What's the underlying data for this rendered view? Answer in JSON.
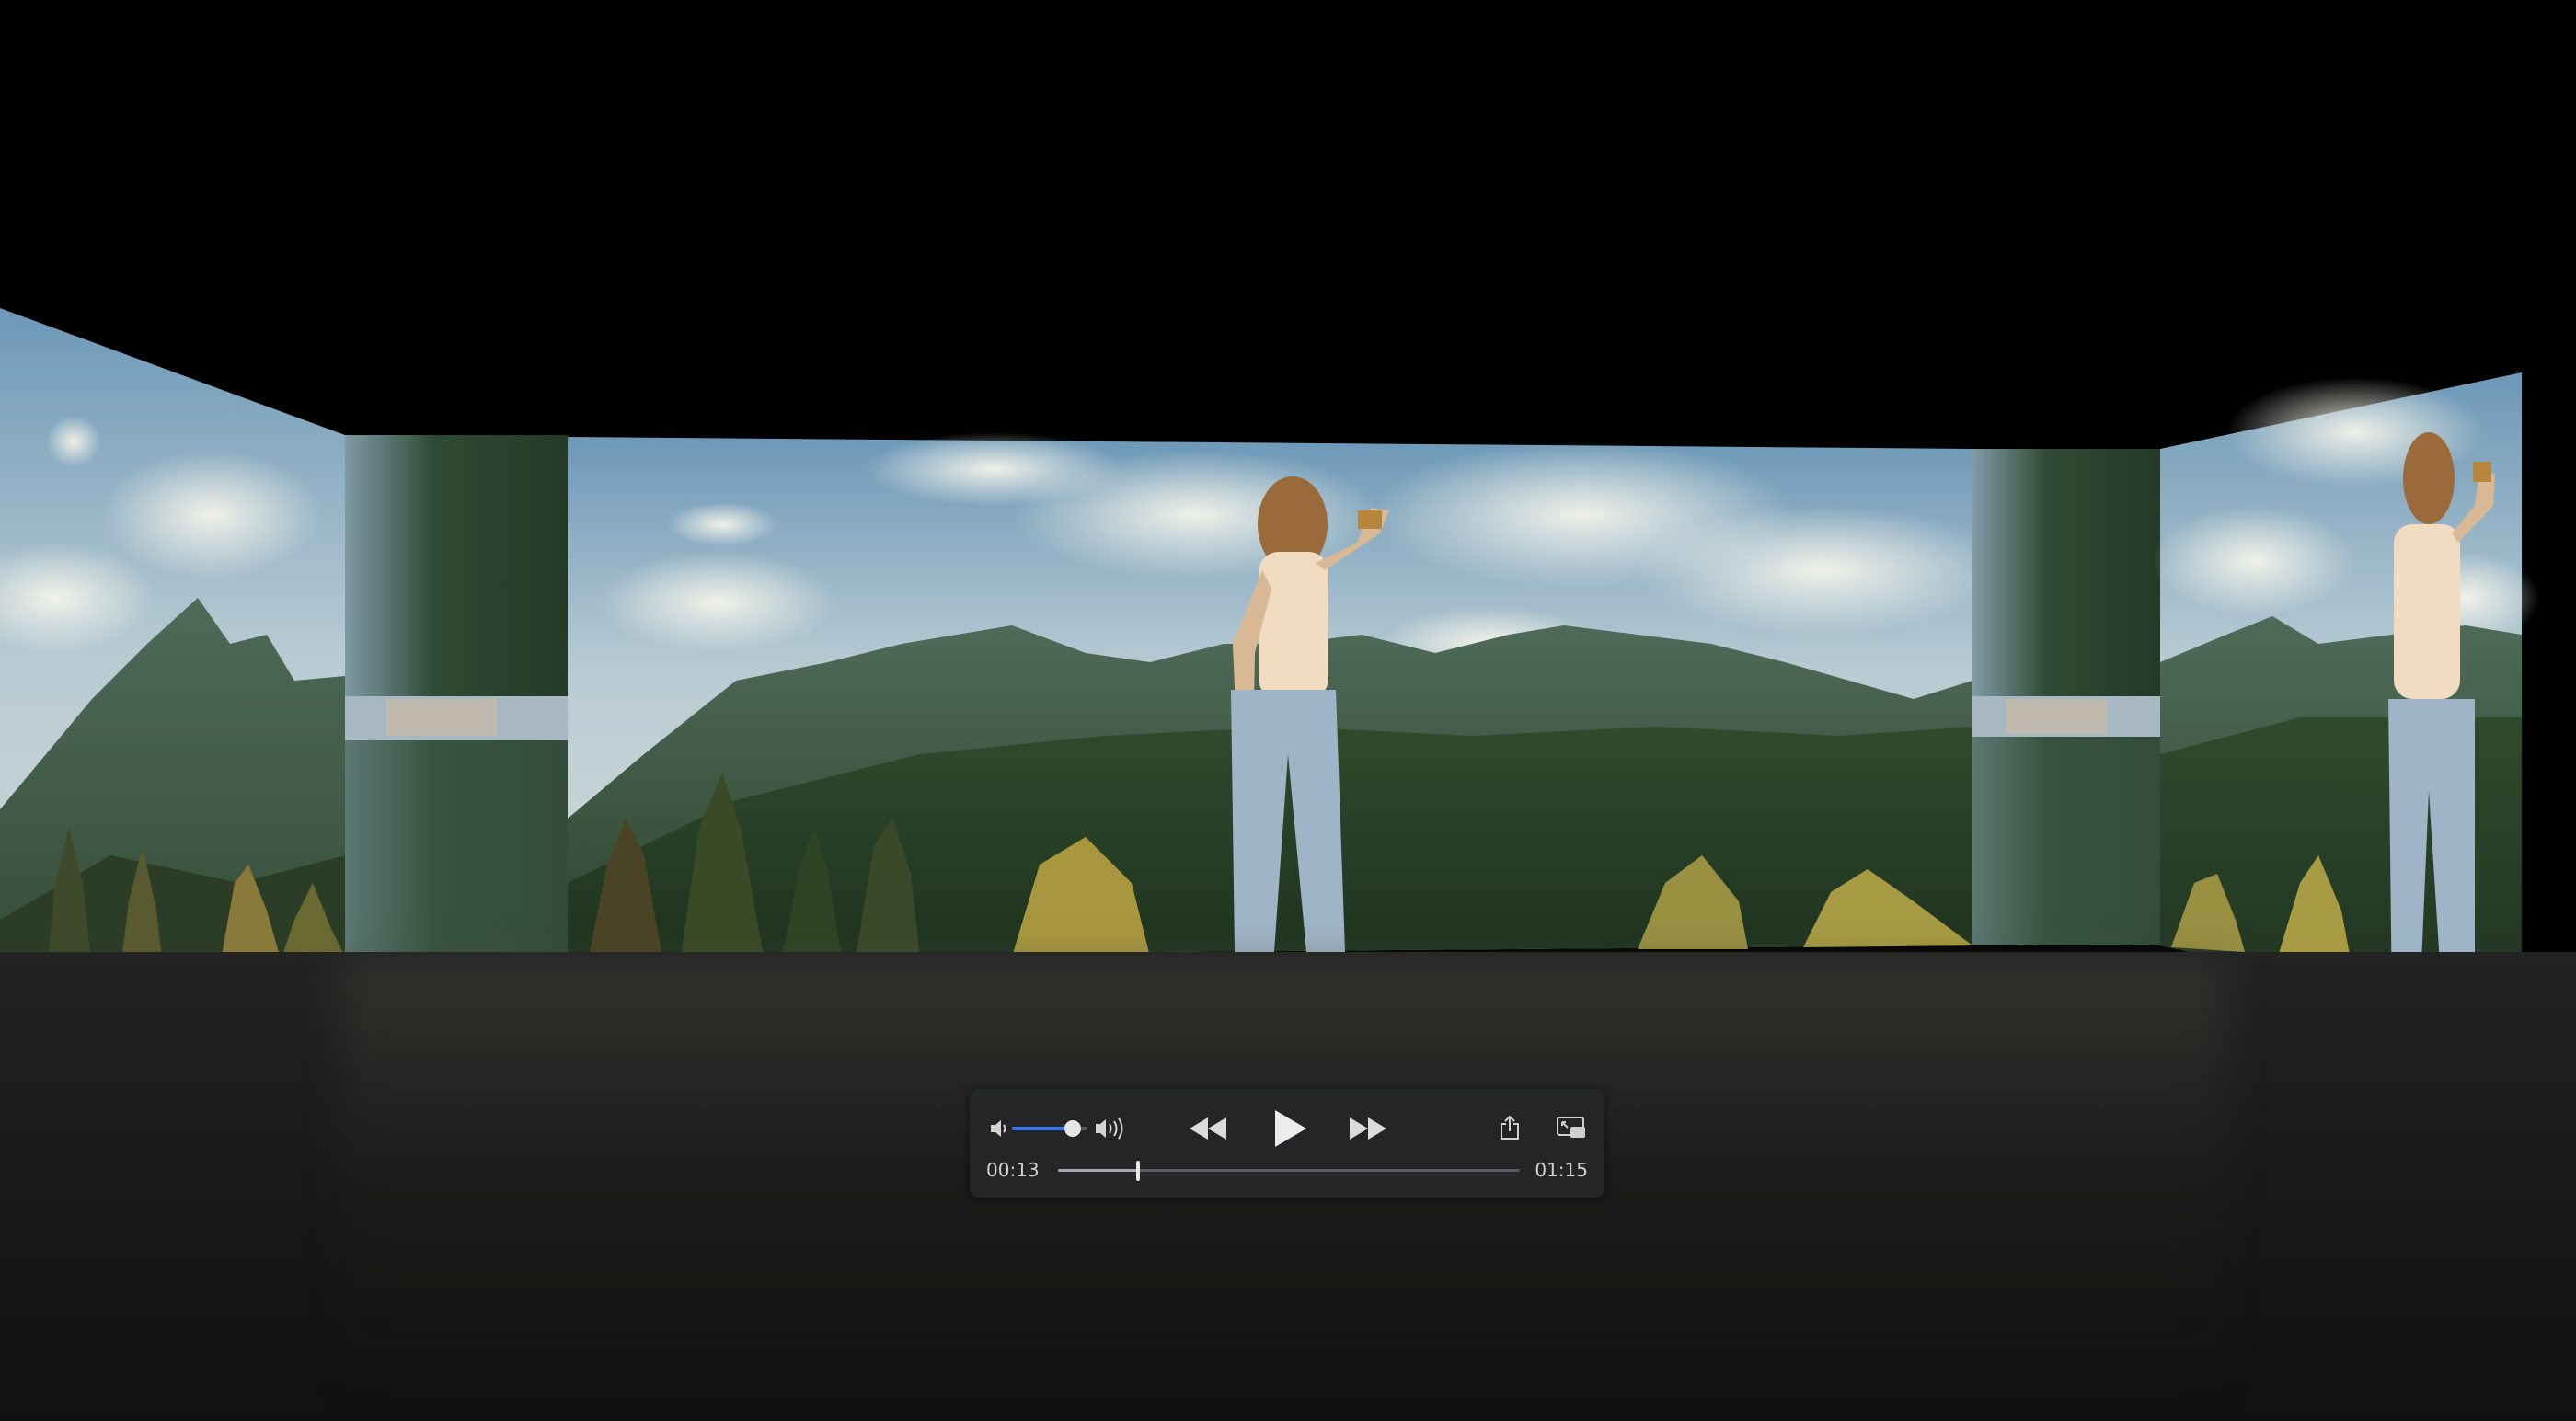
{
  "player": {
    "current_time": "00:13",
    "duration": "01:15",
    "progress": 0.173,
    "volume": 0.8
  },
  "icons": {
    "volume_low": "speaker-low-icon",
    "volume_high": "speaker-high-icon",
    "rewind": "rewind-icon",
    "play": "play-icon",
    "fast_forward": "fast-forward-icon",
    "share": "share-icon",
    "pip": "picture-in-picture-icon"
  },
  "colors": {
    "accent": "#3478f6",
    "panel": "#262628"
  }
}
